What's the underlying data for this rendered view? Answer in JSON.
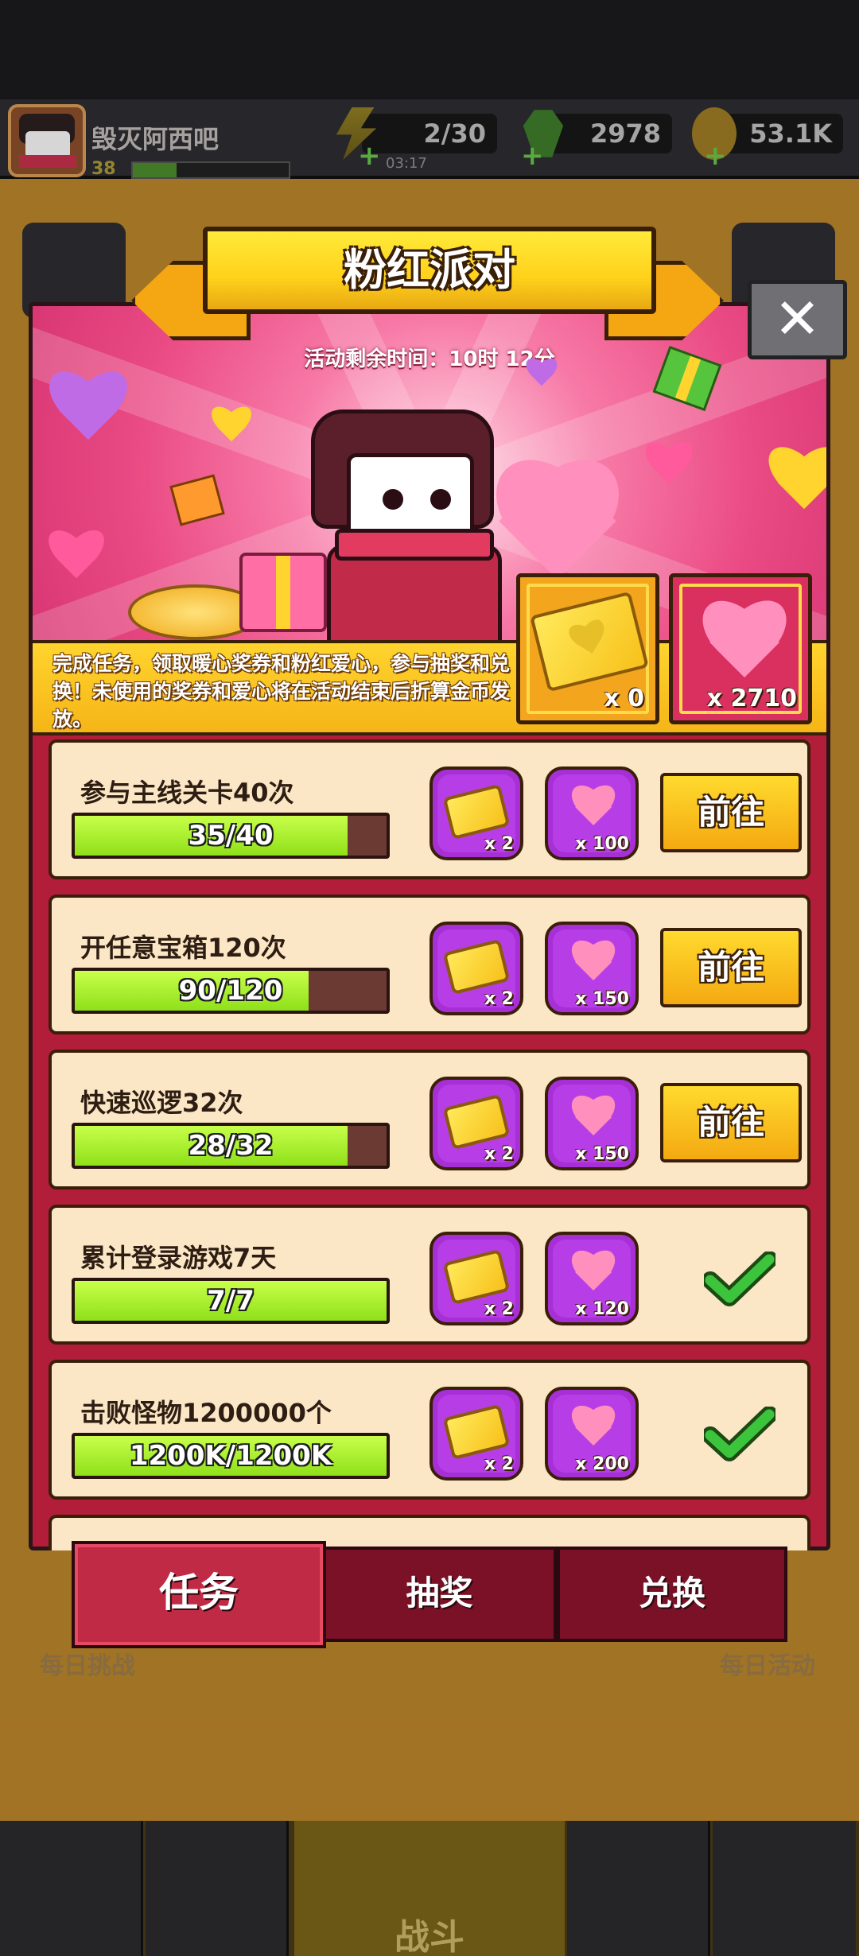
{
  "header": {
    "username": "毁灭阿西吧",
    "level": "38",
    "energy": "2/30",
    "energy_timer": "03:17",
    "gems": "2978",
    "coins": "53.1K"
  },
  "background": {
    "left_label": "每日挑战",
    "right_label": "每日活动",
    "battle_label": "战斗"
  },
  "event": {
    "title": "粉红派对",
    "time_left": "活动剩余时间：10时 12分",
    "description": "完成任务，领取暖心奖券和粉红爱心，参与抽奖和兑换！未使用的奖券和爱心将在活动结束后折算金币发放。",
    "ticket_count": "x 0",
    "heart_count": "x 2710"
  },
  "tasks": [
    {
      "title": "参与主线关卡40次",
      "progress_text": "35/40",
      "progress": 0.875,
      "ticket_reward": "x 2",
      "heart_reward": "x 100",
      "action": "前往",
      "done": false
    },
    {
      "title": "开任意宝箱120次",
      "progress_text": "90/120",
      "progress": 0.75,
      "ticket_reward": "x 2",
      "heart_reward": "x 150",
      "action": "前往",
      "done": false
    },
    {
      "title": "快速巡逻32次",
      "progress_text": "28/32",
      "progress": 0.875,
      "ticket_reward": "x 2",
      "heart_reward": "x 150",
      "action": "前往",
      "done": false
    },
    {
      "title": "累计登录游戏7天",
      "progress_text": "7/7",
      "progress": 1.0,
      "ticket_reward": "x 2",
      "heart_reward": "x 120",
      "action": "",
      "done": true
    },
    {
      "title": "击败怪物1200000个",
      "progress_text": "1200K/1200K",
      "progress": 1.0,
      "ticket_reward": "x 2",
      "heart_reward": "x 200",
      "action": "",
      "done": true
    }
  ],
  "tabs": [
    {
      "label": "任务",
      "active": true
    },
    {
      "label": "抽奖",
      "active": false
    },
    {
      "label": "兑换",
      "active": false
    }
  ],
  "colors": {
    "accent_yellow": "#ffd11a",
    "modal_red": "#b21e3a",
    "progress_green": "#8fe01a",
    "check_green": "#3cc43c"
  }
}
